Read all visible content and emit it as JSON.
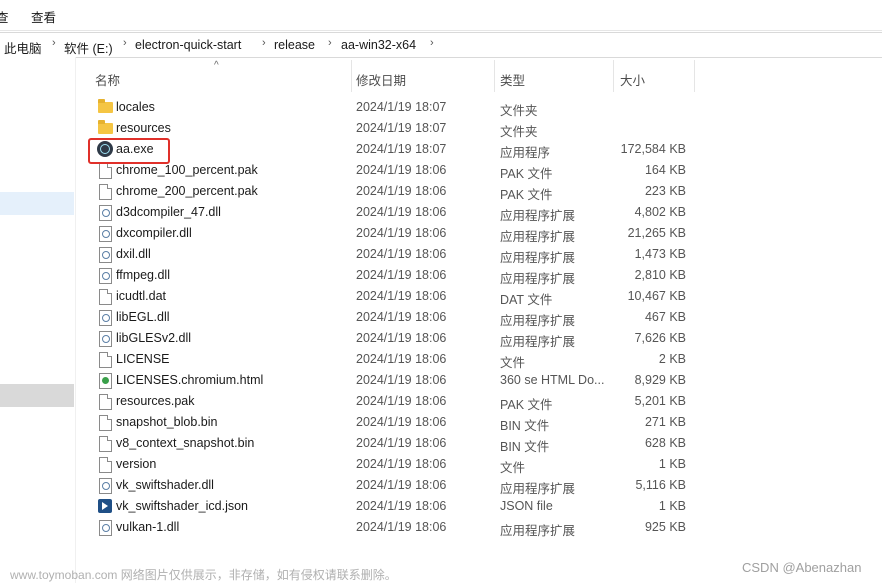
{
  "ribbon": {
    "tab_partial": "查",
    "tab_view": "查看"
  },
  "address": {
    "crumbs": [
      "此电脑",
      "软件 (E:)",
      "electron-quick-start",
      "release",
      "aa-win32-x64"
    ]
  },
  "columns": {
    "name": "名称",
    "date": "修改日期",
    "type": "类型",
    "size": "大小"
  },
  "files": [
    {
      "name": "locales",
      "date": "2024/1/19 18:07",
      "type": "文件夹",
      "size": "",
      "icon": "folder-icon"
    },
    {
      "name": "resources",
      "date": "2024/1/19 18:07",
      "type": "文件夹",
      "size": "",
      "icon": "folder-icon"
    },
    {
      "name": "aa.exe",
      "date": "2024/1/19 18:07",
      "type": "应用程序",
      "size": "172,584 KB",
      "icon": "electron-app-icon"
    },
    {
      "name": "chrome_100_percent.pak",
      "date": "2024/1/19 18:06",
      "type": "PAK 文件",
      "size": "164 KB",
      "icon": "file-icon"
    },
    {
      "name": "chrome_200_percent.pak",
      "date": "2024/1/19 18:06",
      "type": "PAK 文件",
      "size": "223 KB",
      "icon": "file-icon"
    },
    {
      "name": "d3dcompiler_47.dll",
      "date": "2024/1/19 18:06",
      "type": "应用程序扩展",
      "size": "4,802 KB",
      "icon": "dll-icon"
    },
    {
      "name": "dxcompiler.dll",
      "date": "2024/1/19 18:06",
      "type": "应用程序扩展",
      "size": "21,265 KB",
      "icon": "dll-icon"
    },
    {
      "name": "dxil.dll",
      "date": "2024/1/19 18:06",
      "type": "应用程序扩展",
      "size": "1,473 KB",
      "icon": "dll-icon"
    },
    {
      "name": "ffmpeg.dll",
      "date": "2024/1/19 18:06",
      "type": "应用程序扩展",
      "size": "2,810 KB",
      "icon": "dll-icon"
    },
    {
      "name": "icudtl.dat",
      "date": "2024/1/19 18:06",
      "type": "DAT 文件",
      "size": "10,467 KB",
      "icon": "file-icon"
    },
    {
      "name": "libEGL.dll",
      "date": "2024/1/19 18:06",
      "type": "应用程序扩展",
      "size": "467 KB",
      "icon": "dll-icon"
    },
    {
      "name": "libGLESv2.dll",
      "date": "2024/1/19 18:06",
      "type": "应用程序扩展",
      "size": "7,626 KB",
      "icon": "dll-icon"
    },
    {
      "name": "LICENSE",
      "date": "2024/1/19 18:06",
      "type": "文件",
      "size": "2 KB",
      "icon": "file-icon"
    },
    {
      "name": "LICENSES.chromium.html",
      "date": "2024/1/19 18:06",
      "type": "360 se HTML Do...",
      "size": "8,929 KB",
      "icon": "html-icon"
    },
    {
      "name": "resources.pak",
      "date": "2024/1/19 18:06",
      "type": "PAK 文件",
      "size": "5,201 KB",
      "icon": "file-icon"
    },
    {
      "name": "snapshot_blob.bin",
      "date": "2024/1/19 18:06",
      "type": "BIN 文件",
      "size": "271 KB",
      "icon": "file-icon"
    },
    {
      "name": "v8_context_snapshot.bin",
      "date": "2024/1/19 18:06",
      "type": "BIN 文件",
      "size": "628 KB",
      "icon": "file-icon"
    },
    {
      "name": "version",
      "date": "2024/1/19 18:06",
      "type": "文件",
      "size": "1 KB",
      "icon": "file-icon"
    },
    {
      "name": "vk_swiftshader.dll",
      "date": "2024/1/19 18:06",
      "type": "应用程序扩展",
      "size": "5,116 KB",
      "icon": "dll-icon"
    },
    {
      "name": "vk_swiftshader_icd.json",
      "date": "2024/1/19 18:06",
      "type": "JSON file",
      "size": "1 KB",
      "icon": "vscode-json-icon"
    },
    {
      "name": "vulkan-1.dll",
      "date": "2024/1/19 18:06",
      "type": "应用程序扩展",
      "size": "925 KB",
      "icon": "dll-icon"
    }
  ],
  "watermarks": {
    "left": "www.toymoban.com 网络图片仅供展示，非存储，如有侵权请联系删除。",
    "right": "CSDN @Abenazhan"
  }
}
